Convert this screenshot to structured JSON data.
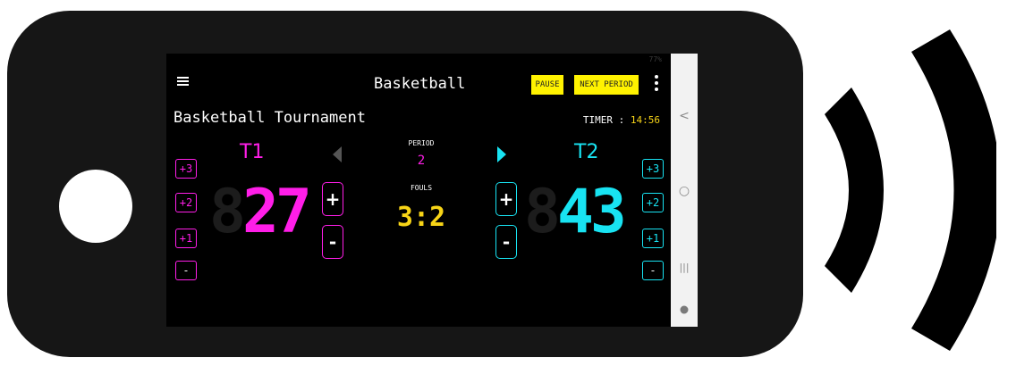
{
  "app": {
    "title": "Basketball",
    "pause_label": "PAUSE",
    "next_period_label": "NEXT PERIOD",
    "status_text": "77%"
  },
  "tournament": {
    "name": "Basketball Tournament",
    "timer_label": "TIMER :",
    "timer_value": "14:56"
  },
  "teams": {
    "t1": {
      "name": "T1",
      "score": "27",
      "ghost_digit": "8",
      "color": "#ff1ee8",
      "buttons": [
        "+3",
        "+2",
        "+1",
        "-"
      ]
    },
    "t2": {
      "name": "T2",
      "score": "43",
      "ghost_digit": "8",
      "color": "#18e3f2",
      "buttons": [
        "+3",
        "+2",
        "+1",
        "-"
      ]
    }
  },
  "center": {
    "period_label": "PERIOD",
    "period_value": "2",
    "fouls_label": "FOULS",
    "fouls_value": "3:2"
  },
  "controls": {
    "plus": "+",
    "minus": "-"
  },
  "navbar": {
    "back": "<",
    "home": "○",
    "recents": "|||"
  },
  "colors": {
    "accent_yellow": "#fff200",
    "timer_yellow": "#f7d417",
    "background": "#000000"
  }
}
